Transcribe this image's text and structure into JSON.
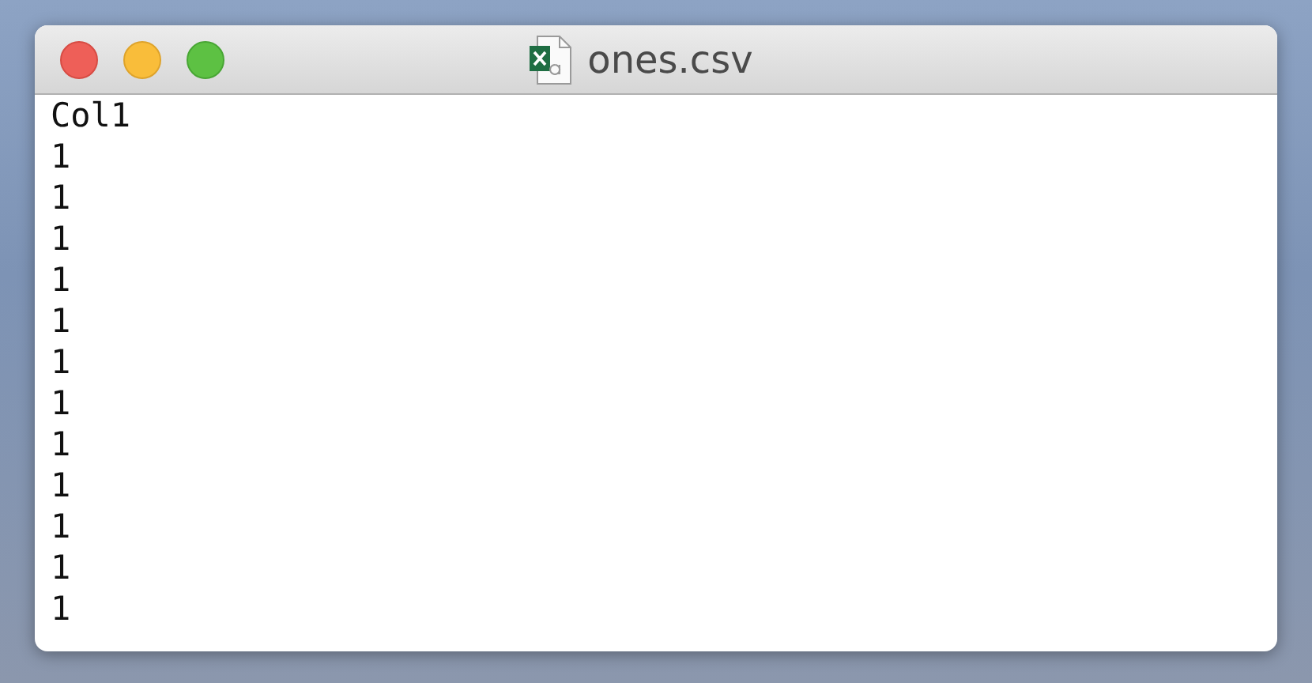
{
  "window": {
    "title": "ones.csv"
  },
  "lines": [
    "Col1",
    "1",
    "1",
    "1",
    "1",
    "1",
    "1",
    "1",
    "1",
    "1",
    "1",
    "1",
    "1"
  ]
}
